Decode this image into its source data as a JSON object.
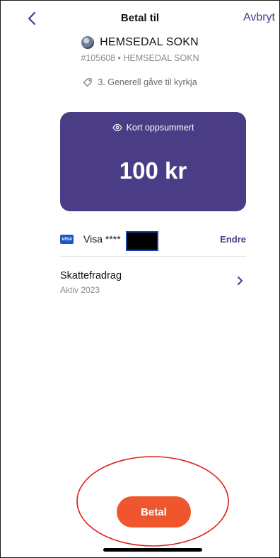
{
  "header": {
    "title": "Betal til",
    "cancel_label": "Avbryt"
  },
  "recipient": {
    "name": "HEMSEDAL SOKN",
    "id_line": "#105608 • HEMSEDAL SOKN",
    "purpose": "3. Generell gåve til kyrkja"
  },
  "summary_card": {
    "heading": "Kort oppsummert",
    "amount": "100 kr",
    "color": "#4a3d85"
  },
  "payment_method": {
    "brand_badge": "VISA",
    "label": "Visa ****",
    "change_label": "Endre"
  },
  "tax_deduction": {
    "title": "Skattefradrag",
    "status": "Aktiv 2023"
  },
  "pay_button": {
    "label": "Betal",
    "color": "#f0562e"
  },
  "icons": {
    "back": "chevron-left-icon",
    "tag": "tag-icon",
    "eye": "eye-icon",
    "chevron": "chevron-right-icon"
  }
}
